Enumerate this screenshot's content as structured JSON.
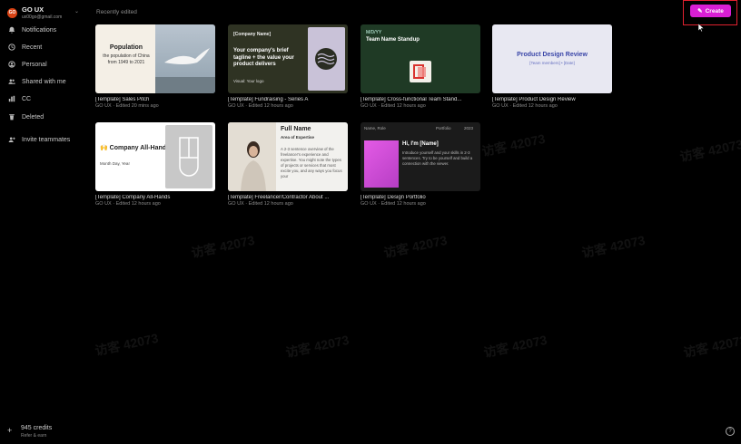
{
  "account": {
    "initials": "GO",
    "name": "GO UX",
    "email": "ux00go@gmail.com"
  },
  "sidebar": {
    "items": [
      {
        "label": "Notifications",
        "icon": "bell-icon"
      },
      {
        "label": "Recent",
        "icon": "clock-icon"
      },
      {
        "label": "Personal",
        "icon": "user-icon"
      },
      {
        "label": "Shared with me",
        "icon": "users-icon"
      },
      {
        "label": "CC",
        "icon": "chart-icon"
      },
      {
        "label": "Deleted",
        "icon": "trash-icon"
      },
      {
        "label": "Invite teammates",
        "icon": "add-user-icon"
      }
    ],
    "credits": "945 credits",
    "credits_sub": "Refer & earn"
  },
  "main": {
    "section_title": "Recently edited",
    "create_label": "Create"
  },
  "cards": [
    {
      "title": "[Template] Sales Pitch",
      "meta": "GO UX · Edited 20 mins ago",
      "thumb": {
        "heading": "Population",
        "sub": "the population of China from 1949 to 2021"
      }
    },
    {
      "title": "[Template] Fundraising - Series A",
      "meta": "GO UX · Edited 12 hours ago",
      "thumb": {
        "top": "[Company Name]",
        "tagline": "Your company's brief tagline + the value your product delivers",
        "foot": "Visual: Your logo"
      }
    },
    {
      "title": "[Template] Cross-functional Team Stand...",
      "meta": "GO UX · Edited 12 hours ago",
      "thumb": {
        "date": "M/D/YY",
        "heading": "Team Name Standup"
      }
    },
    {
      "title": "[Template] Product Design Review",
      "meta": "GO UX · Edited 12 hours ago",
      "thumb": {
        "heading": "Product Design Review",
        "sub": "[Team members] • [Date]"
      }
    },
    {
      "title": "[Template] Company All-Hands",
      "meta": "GO UX · Edited 12 hours ago",
      "thumb": {
        "heading": "🙌 Company All-Hands",
        "sub": "Month Day, Year"
      }
    },
    {
      "title": "[Template] Freelancer/Contractor About ...",
      "meta": "GO UX · Edited 12 hours ago",
      "thumb": {
        "heading": "Full Name",
        "sub": "Area of Expertise",
        "body": "A 2-3 sentence overview of the freelancer's experience and expertise. You might note the types of projects or services that most excite you, and any ways you focus your"
      }
    },
    {
      "title": "[Template] Design Portfolio",
      "meta": "GO UX · Edited 12 hours ago",
      "thumb": {
        "tl": "Name, Role",
        "tm": "Portfolio",
        "tr": "2023",
        "heading": "Hi, I'm [Name]",
        "body": "Introduce yourself and your skills in 2-3 sentences. Try to be yourself and build a connection with the viewer."
      }
    }
  ],
  "watermark": "访客 42073"
}
